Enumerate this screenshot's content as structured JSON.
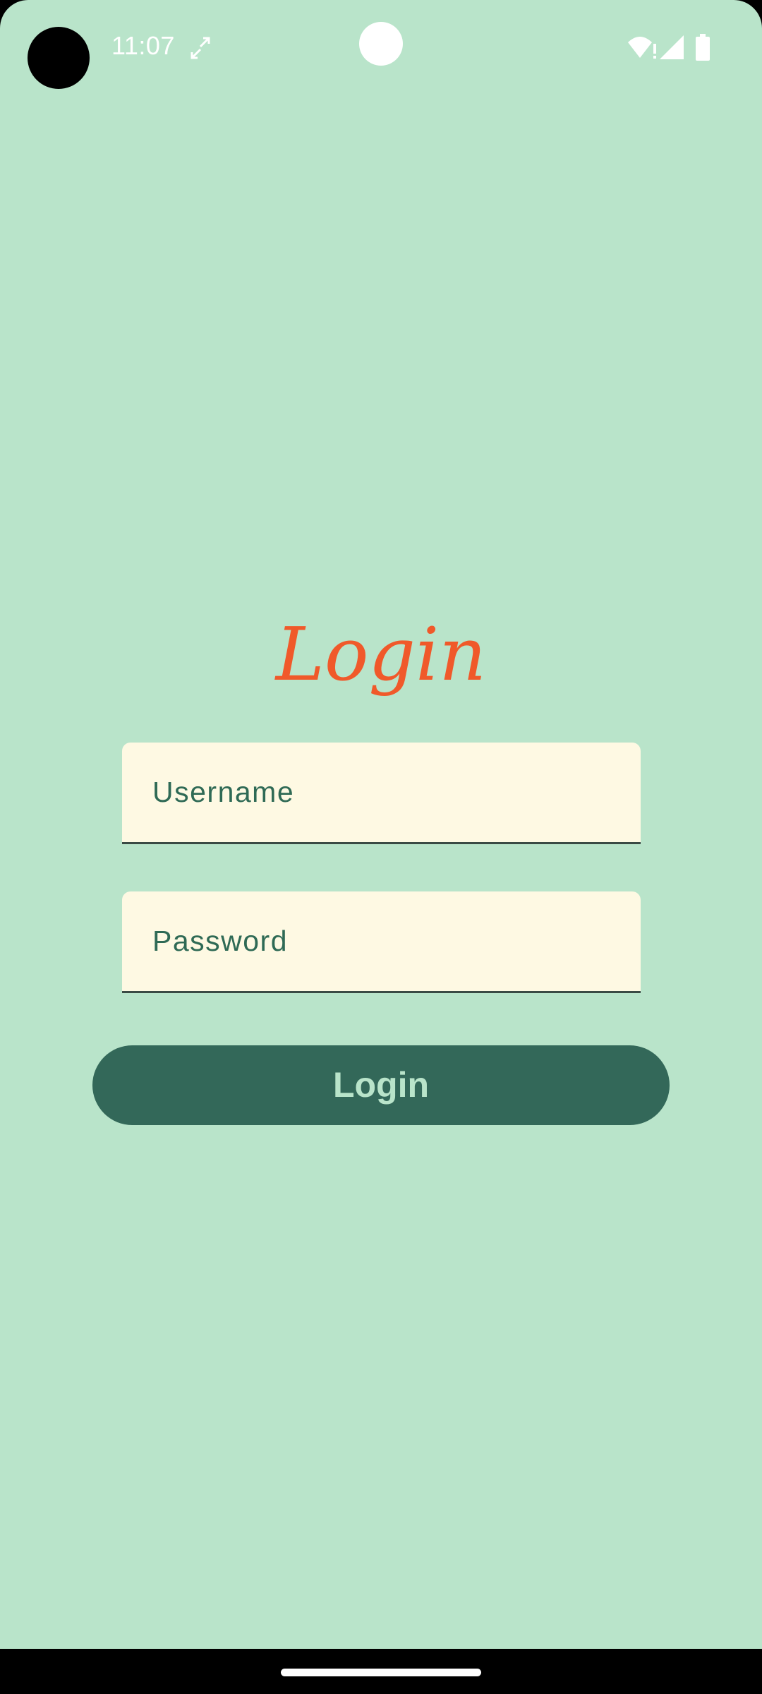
{
  "status_bar": {
    "time": "11:07",
    "icons": [
      "sync-icon",
      "wifi-alert-icon",
      "cell-signal-icon",
      "battery-icon"
    ]
  },
  "login": {
    "title": "Login",
    "username_placeholder": "Username",
    "password_placeholder": "Password",
    "button_label": "Login"
  },
  "colors": {
    "background": "#b9e4ca",
    "title": "#f0592a",
    "field_background": "#fef9e3",
    "button": "#336859",
    "button_text": "#b9e4ca",
    "field_text": "#2f6a55"
  }
}
